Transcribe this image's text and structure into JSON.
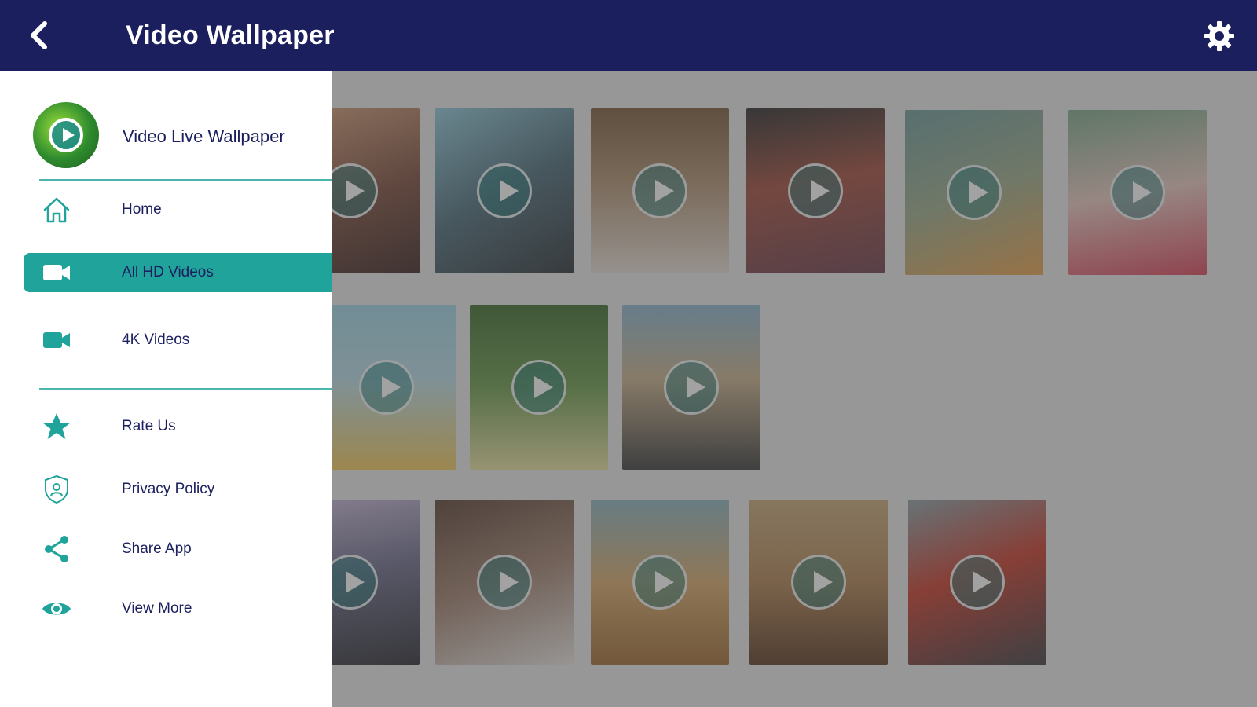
{
  "appbar": {
    "title": "Video Wallpaper",
    "back_icon": "back-arrow-icon",
    "settings_icon": "gear-icon",
    "background_color": "#1b1f5e"
  },
  "drawer": {
    "app_name": "Video Live Wallpaper",
    "accent_color": "#1fa39a",
    "items": [
      {
        "label": "Home",
        "icon": "home-icon",
        "active": false
      },
      {
        "label": "All HD Videos",
        "icon": "video-camera-icon",
        "active": true
      },
      {
        "label": "4K Videos",
        "icon": "video-camera-icon",
        "active": false
      },
      {
        "label": "Rate Us",
        "icon": "star-icon",
        "active": false
      },
      {
        "label": "Privacy Policy",
        "icon": "shield-icon",
        "active": false
      },
      {
        "label": "Share App",
        "icon": "share-icon",
        "active": false
      },
      {
        "label": "View More",
        "icon": "eye-icon",
        "active": false
      }
    ]
  },
  "grid": {
    "thumbnail_count": 16,
    "play_icon": "play-icon"
  }
}
